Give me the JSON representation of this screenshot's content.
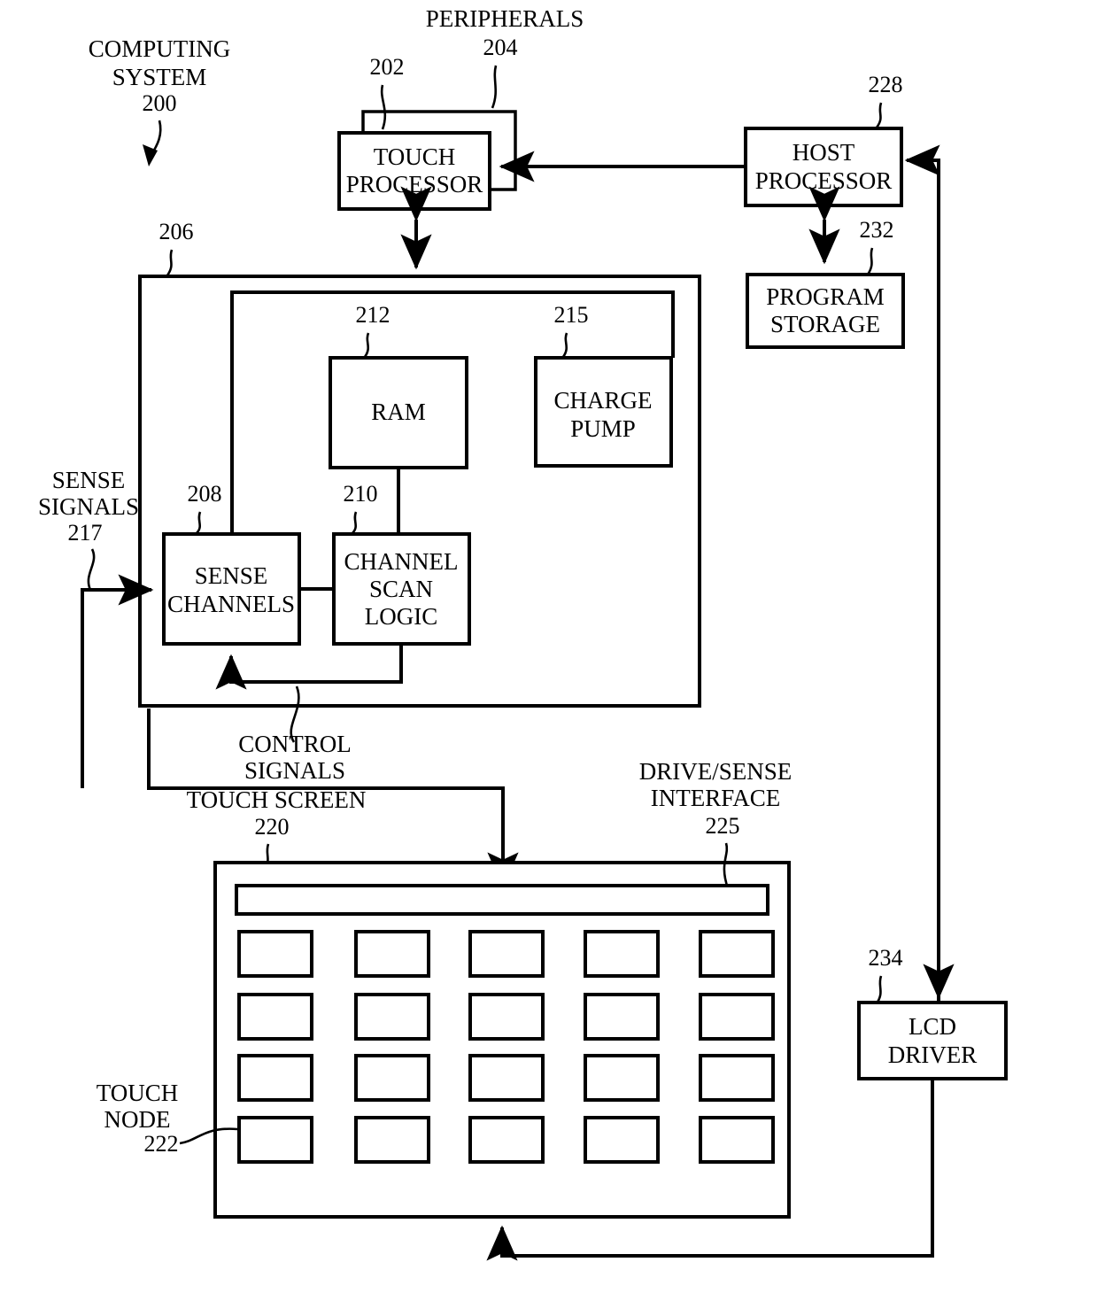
{
  "figure": {
    "title": "Computing system block diagram",
    "blocks": [
      {
        "id": "peripherals",
        "label": "",
        "ref": "204",
        "ref_label": "PERIPHERALS"
      },
      {
        "id": "touch-processor",
        "label": "TOUCH\nPROCESSOR",
        "line1": "TOUCH",
        "line2": "PROCESSOR",
        "ref": "202"
      },
      {
        "id": "host-processor",
        "line1": "HOST",
        "line2": "PROCESSOR",
        "ref": "228"
      },
      {
        "id": "program-storage",
        "line1": "PROGRAM",
        "line2": "STORAGE",
        "ref": "232"
      },
      {
        "id": "touch-controller",
        "label": "",
        "ref": "206"
      },
      {
        "id": "ram",
        "line1": "RAM",
        "line2": "",
        "ref": "212"
      },
      {
        "id": "charge-pump",
        "line1": "CHARGE",
        "line2": "PUMP",
        "ref": "215"
      },
      {
        "id": "sense-channels",
        "line1": "SENSE",
        "line2": "CHANNELS",
        "ref": "208"
      },
      {
        "id": "channel-scan-logic",
        "line1": "CHANNEL",
        "line2": "SCAN",
        "line3": "LOGIC",
        "ref": "210"
      },
      {
        "id": "touch-screen",
        "label": "",
        "ref": "220",
        "ref_label": "TOUCH SCREEN"
      },
      {
        "id": "drive-sense-interface",
        "label": "",
        "ref": "225",
        "ref_label_1": "DRIVE/SENSE",
        "ref_label_2": "INTERFACE"
      },
      {
        "id": "touch-node",
        "label": "",
        "ref": "222",
        "ref_label_1": "TOUCH",
        "ref_label_2": "NODE"
      },
      {
        "id": "lcd-driver",
        "line1": "LCD",
        "line2": "DRIVER",
        "ref": "234"
      }
    ],
    "labels": {
      "computing_system_1": "COMPUTING",
      "computing_system_2": "SYSTEM",
      "computing_system_ref": "200",
      "peripherals": "PERIPHERALS",
      "peripherals_ref": "204",
      "touch_processor_ref": "202",
      "touch_processor_1": "TOUCH",
      "touch_processor_2": "PROCESSOR",
      "host_processor_ref": "228",
      "host_processor_1": "HOST",
      "host_processor_2": "PROCESSOR",
      "program_storage_ref": "232",
      "program_storage_1": "PROGRAM",
      "program_storage_2": "STORAGE",
      "touch_controller_ref": "206",
      "ram_ref": "212",
      "ram": "RAM",
      "charge_pump_ref": "215",
      "charge_pump_1": "CHARGE",
      "charge_pump_2": "PUMP",
      "sense_channels_ref": "208",
      "sense_channels_1": "SENSE",
      "sense_channels_2": "CHANNELS",
      "channel_scan_ref": "210",
      "channel_scan_1": "CHANNEL",
      "channel_scan_2": "SCAN",
      "channel_scan_3": "LOGIC",
      "sense_signals_1": "SENSE",
      "sense_signals_2": "SIGNALS",
      "sense_signals_ref": "217",
      "control_signals_1": "CONTROL",
      "control_signals_2": "SIGNALS",
      "touch_screen": "TOUCH SCREEN",
      "touch_screen_ref": "220",
      "drive_sense_1": "DRIVE/SENSE",
      "drive_sense_2": "INTERFACE",
      "drive_sense_ref": "225",
      "touch_node_1": "TOUCH",
      "touch_node_2": "NODE",
      "touch_node_ref": "222",
      "lcd_driver_1": "LCD",
      "lcd_driver_2": "DRIVER",
      "lcd_driver_ref": "234"
    },
    "touch_screen_grid": {
      "rows": 4,
      "cols": 5
    },
    "colors": {
      "stroke": "#000000",
      "background": "#ffffff"
    }
  }
}
